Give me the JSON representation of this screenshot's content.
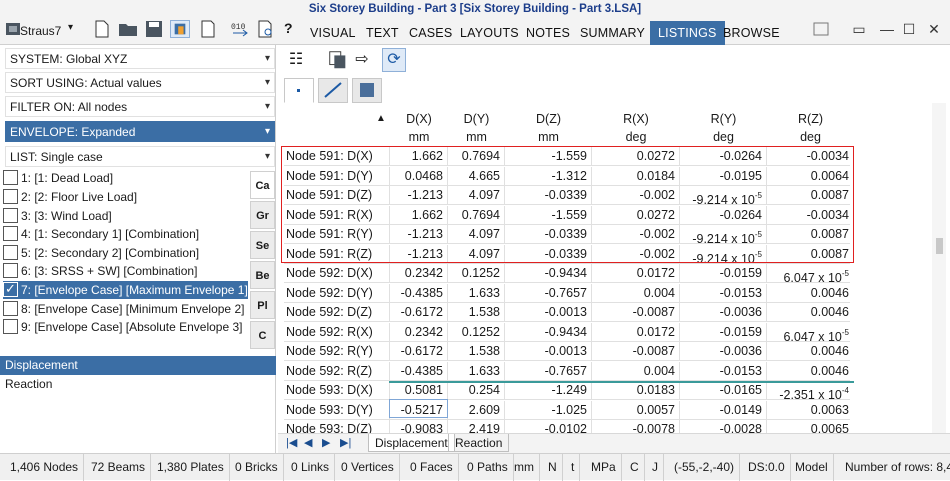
{
  "window": {
    "title": "Six Storey Building - Part 3 [Six Storey Building - Part 3.LSA]",
    "product": "Straus7"
  },
  "menu": {
    "items": [
      "VISUAL",
      "TEXT",
      "CASES",
      "LAYOUTS",
      "NOTES",
      "SUMMARY",
      "LISTINGS",
      "BROWSE"
    ],
    "active": "LISTINGS"
  },
  "left": {
    "dropdowns": [
      "SYSTEM: Global XYZ",
      "SORT USING: Actual values",
      "FILTER ON: All nodes",
      "ENVELOPE: Expanded",
      "LIST: Single case"
    ],
    "cases": [
      "1: [1: Dead Load]",
      "2: [2: Floor Live Load]",
      "3: [3: Wind Load]",
      "4: [1: Secondary 1] [Combination]",
      "5: [2: Secondary 2] [Combination]",
      "6: [3: SRSS + SW] [Combination]",
      "7: [Envelope Case] [Maximum Envelope 1]",
      "8: [Envelope Case] [Minimum Envelope 2]",
      "9: [Envelope Case] [Absolute Envelope 3]"
    ],
    "checked_case_index": 6,
    "vtabs": [
      "Ca",
      "Gr",
      "Se",
      "Be",
      "Pl",
      "C"
    ],
    "results": [
      "Displacement",
      "Reaction"
    ],
    "selected_result": "Displacement"
  },
  "grid": {
    "columns": [
      {
        "name": "D(X)",
        "unit": "mm"
      },
      {
        "name": "D(Y)",
        "unit": "mm"
      },
      {
        "name": "D(Z)",
        "unit": "mm"
      },
      {
        "name": "R(X)",
        "unit": "deg"
      },
      {
        "name": "R(Y)",
        "unit": "deg"
      },
      {
        "name": "R(Z)",
        "unit": "deg"
      }
    ],
    "rows": [
      {
        "label": "Node 591: D(X)",
        "v": [
          "1.662",
          "0.7694",
          "-1.559",
          "0.0272",
          "-0.0264",
          "-0.0034"
        ]
      },
      {
        "label": "Node 591: D(Y)",
        "v": [
          "0.0468",
          "4.665",
          "-1.312",
          "0.0184",
          "-0.0195",
          "0.0064"
        ]
      },
      {
        "label": "Node 591: D(Z)",
        "v": [
          "-1.213",
          "4.097",
          "-0.0339",
          "-0.002",
          "-9.214 x 10",
          "0.0087"
        ],
        "exp": [
          null,
          null,
          null,
          null,
          "-5",
          null
        ]
      },
      {
        "label": "Node 591: R(X)",
        "v": [
          "1.662",
          "0.7694",
          "-1.559",
          "0.0272",
          "-0.0264",
          "-0.0034"
        ]
      },
      {
        "label": "Node 591: R(Y)",
        "v": [
          "-1.213",
          "4.097",
          "-0.0339",
          "-0.002",
          "-9.214 x 10",
          "0.0087"
        ],
        "exp": [
          null,
          null,
          null,
          null,
          "-5",
          null
        ]
      },
      {
        "label": "Node 591: R(Z)",
        "v": [
          "-1.213",
          "4.097",
          "-0.0339",
          "-0.002",
          "-9.214 x 10",
          "0.0087"
        ],
        "exp": [
          null,
          null,
          null,
          null,
          "-5",
          null
        ]
      },
      {
        "label": "Node 592: D(X)",
        "v": [
          "0.2342",
          "0.1252",
          "-0.9434",
          "0.0172",
          "-0.0159",
          "6.047 x 10"
        ],
        "exp": [
          null,
          null,
          null,
          null,
          null,
          "-5"
        ]
      },
      {
        "label": "Node 592: D(Y)",
        "v": [
          "-0.4385",
          "1.633",
          "-0.7657",
          "0.004",
          "-0.0153",
          "0.0046"
        ]
      },
      {
        "label": "Node 592: D(Z)",
        "v": [
          "-0.6172",
          "1.538",
          "-0.0013",
          "-0.0087",
          "-0.0036",
          "0.0046"
        ]
      },
      {
        "label": "Node 592: R(X)",
        "v": [
          "0.2342",
          "0.1252",
          "-0.9434",
          "0.0172",
          "-0.0159",
          "6.047 x 10"
        ],
        "exp": [
          null,
          null,
          null,
          null,
          null,
          "-5"
        ]
      },
      {
        "label": "Node 592: R(Y)",
        "v": [
          "-0.6172",
          "1.538",
          "-0.0013",
          "-0.0087",
          "-0.0036",
          "0.0046"
        ]
      },
      {
        "label": "Node 592: R(Z)",
        "v": [
          "-0.4385",
          "1.633",
          "-0.7657",
          "0.004",
          "-0.0153",
          "0.0046"
        ]
      },
      {
        "label": "Node 593: D(X)",
        "v": [
          "0.5081",
          "0.254",
          "-1.249",
          "0.0183",
          "-0.0165",
          "-2.351 x 10"
        ],
        "exp": [
          null,
          null,
          null,
          null,
          null,
          "-4"
        ]
      },
      {
        "label": "Node 593: D(Y)",
        "v": [
          "-0.5217",
          "2.609",
          "-1.025",
          "0.0057",
          "-0.0149",
          "0.0063"
        ]
      },
      {
        "label": "Node 593: D(Z)",
        "v": [
          "-0.9083",
          "2.419",
          "-0.0102",
          "-0.0078",
          "-0.0028",
          "0.0065"
        ]
      }
    ]
  },
  "bottom_tabs": [
    "Displacement",
    "Reaction"
  ],
  "status": [
    "1,406 Nodes",
    "72 Beams",
    "1,380 Plates",
    "0 Bricks",
    "0 Links",
    "0 Vertices",
    "0 Faces",
    "0 Paths",
    "mm",
    "N",
    "t",
    "MPa",
    "C",
    "J",
    "(-55,-2,-40)",
    "DS:0.0",
    "Model",
    "Number of rows: 8,4"
  ],
  "help_glyph": "?",
  "win_controls": [
    "—",
    "☐",
    "✕"
  ],
  "tool_glyphs": {
    "grid": "☷",
    "export": "⇨",
    "refresh": "⟳",
    "nav": [
      "|◀",
      "◀",
      "▶",
      "▶|"
    ]
  }
}
